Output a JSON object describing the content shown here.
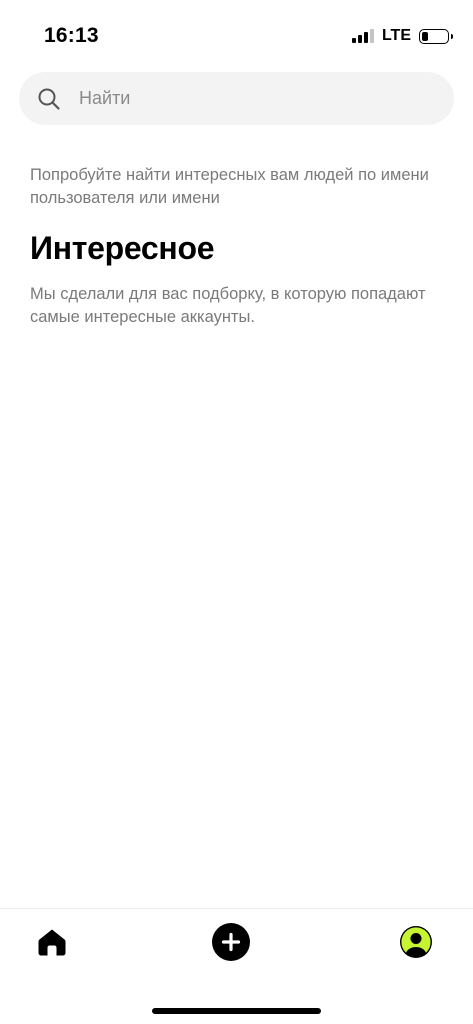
{
  "status_bar": {
    "time": "16:13",
    "network": "LTE",
    "signal_bars_active": 3,
    "signal_bars_total": 4,
    "battery_level": 0.2
  },
  "search": {
    "placeholder": "Найти",
    "value": "",
    "icon": "search-icon"
  },
  "main": {
    "hint": "Попробуйте найти интересных вам людей по имени пользователя или имени",
    "section_title": "Интересное",
    "section_description": "Мы сделали для вас подборку, в которую попадают самые интересные аккаунты."
  },
  "tab_bar": {
    "items": [
      {
        "id": "home",
        "icon": "home-icon"
      },
      {
        "id": "add",
        "icon": "plus-circle-icon"
      },
      {
        "id": "profile",
        "icon": "avatar-icon",
        "accent": "#c6f432"
      }
    ]
  },
  "colors": {
    "search_background": "#f3f3f3",
    "secondary_text": "#7a7a7a",
    "avatar_accent": "#c6f432"
  }
}
